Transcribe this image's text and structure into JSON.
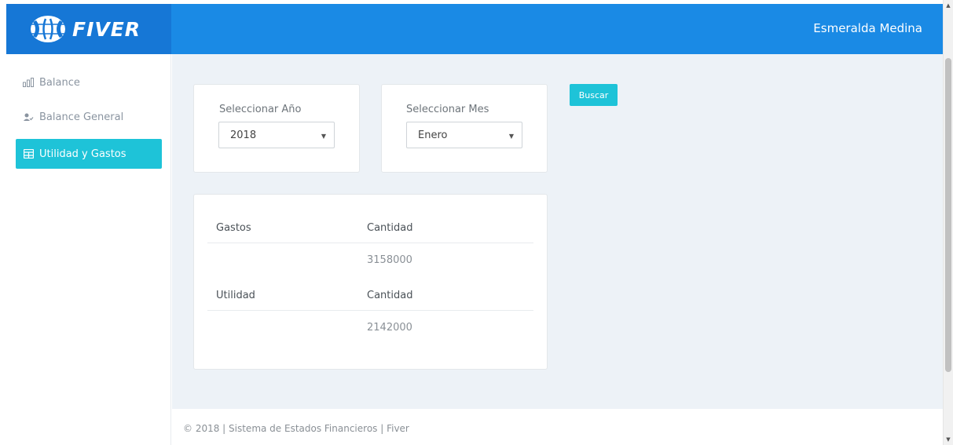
{
  "app": {
    "logo_text": "FIVER",
    "user_name": "Esmeralda Medina"
  },
  "sidebar": {
    "items": [
      {
        "label": "Balance",
        "icon": "bar-chart-icon",
        "active": false
      },
      {
        "label": "Balance General",
        "icon": "user-check-icon",
        "active": false
      },
      {
        "label": "Utilidad y Gastos",
        "icon": "table-icon",
        "active": true
      }
    ]
  },
  "filters": {
    "year_label": "Seleccionar Año",
    "year_value": "2018",
    "month_label": "Seleccionar Mes",
    "month_value": "Enero",
    "search_label": "Buscar"
  },
  "results": {
    "gastos_header": "Gastos",
    "gastos_qty_header": "Cantidad",
    "gastos_value": "3158000",
    "utilidad_header": "Utilidad",
    "utilidad_qty_header": "Cantidad",
    "utilidad_value": "2142000"
  },
  "footer": {
    "text": "© 2018 | Sistema de Estados Financieros | Fiver"
  },
  "colors": {
    "topbar": "#1a8ae5",
    "accent": "#1ec3d8",
    "background": "#edf2f7"
  }
}
